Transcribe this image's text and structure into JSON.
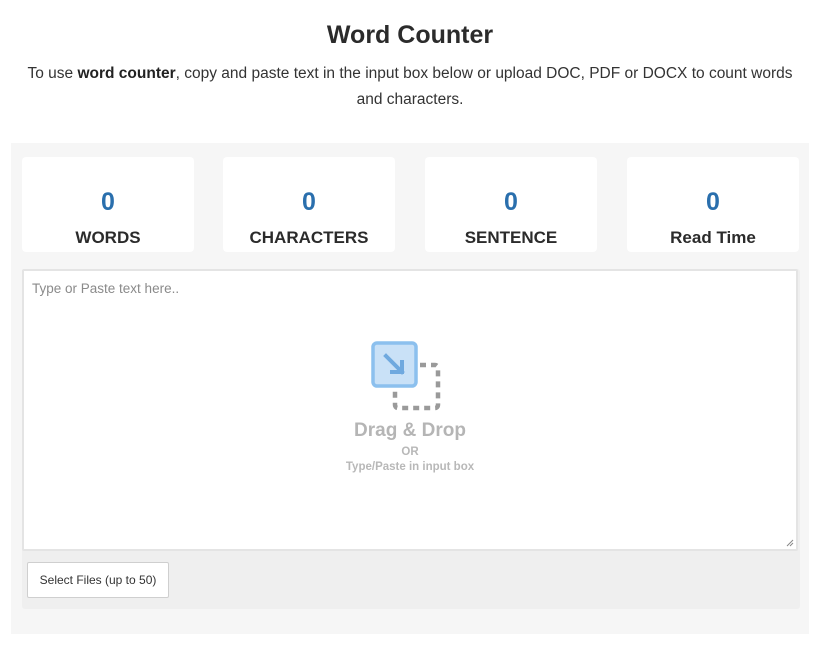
{
  "header": {
    "title": "Word Counter",
    "subtitle_prefix": "To use ",
    "subtitle_bold": "word counter",
    "subtitle_rest": ", copy and paste text in the input box below or upload DOC, PDF or DOCX to count words and characters."
  },
  "stats": [
    {
      "value": "0",
      "label": "WORDS"
    },
    {
      "value": "0",
      "label": "CHARACTERS"
    },
    {
      "value": "0",
      "label": "SENTENCE"
    },
    {
      "value": "0",
      "label": "Read Time"
    }
  ],
  "input": {
    "placeholder": "Type or Paste text here..",
    "value": ""
  },
  "dropzone": {
    "icon": "drag-drop-icon",
    "title": "Drag & Drop",
    "or": "OR",
    "subtitle": "Type/Paste in input box"
  },
  "upload": {
    "button_label": "Select Files (up to 50)"
  },
  "colors": {
    "accent": "#2a6fad",
    "panel_bg": "#f6f6f6",
    "icon_blue": "#7fb5e8"
  }
}
